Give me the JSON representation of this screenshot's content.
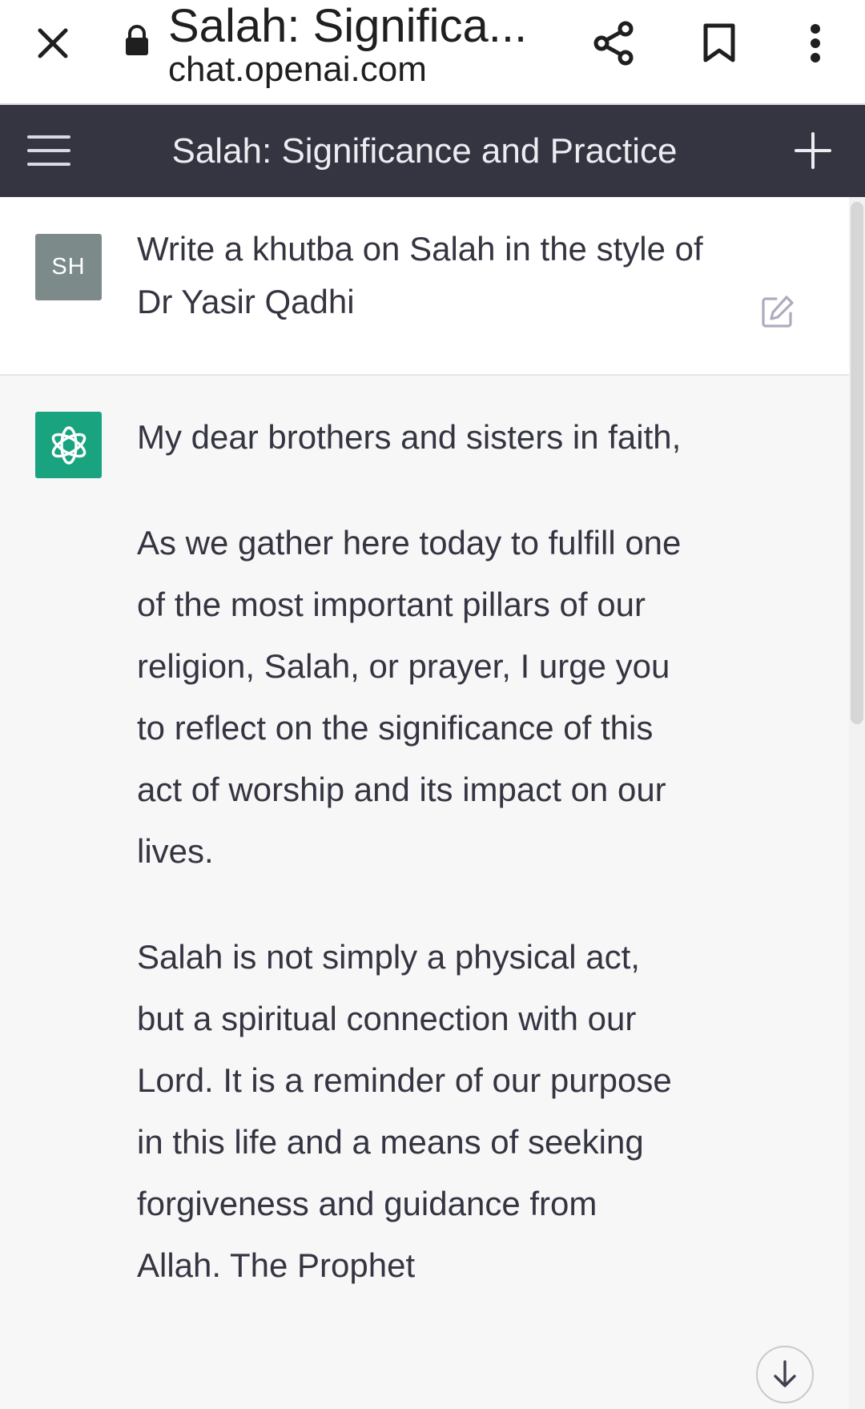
{
  "browser": {
    "page_title": "Salah: Significa...",
    "domain": "chat.openai.com",
    "icons": [
      "close-icon",
      "lock-icon",
      "share-icon",
      "bookmark-icon",
      "more-vert-icon"
    ]
  },
  "header": {
    "title": "Salah: Significance and Practice",
    "icons": [
      "menu-icon",
      "plus-icon"
    ]
  },
  "user_message": {
    "avatar": "SH",
    "text": "Write a khutba on Salah in the style of Dr Yasir Qadhi"
  },
  "assistant_message": {
    "paragraphs": [
      "My dear brothers and sisters in faith,",
      "As we gather here today to fulfill one of the most important pillars of our religion, Salah, or prayer, I urge you to reflect on the significance of this act of worship and its impact on our lives.",
      "Salah is not simply a physical act, but a spiritual connection with our Lord. It is a reminder of our purpose in this life and a means of seeking forgiveness and guidance from Allah. The Prophet"
    ]
  },
  "colors": {
    "header_bg": "#343541",
    "user_avatar_bg": "#7c8b8a",
    "assistant_avatar_bg": "#19a37f",
    "assistant_bg": "#f7f7f8"
  }
}
